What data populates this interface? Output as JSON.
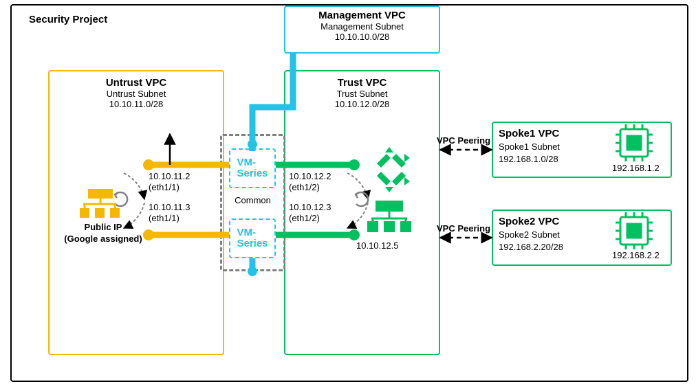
{
  "project": {
    "title": "Security Project"
  },
  "mgmt": {
    "title": "Management VPC",
    "subnet_name": "Management Subnet",
    "cidr": "10.10.10.0/28"
  },
  "untrust": {
    "title": "Untrust VPC",
    "subnet_name": "Untrust Subnet",
    "cidr": "10.10.11.0/28",
    "ip1": "10.10.11.2",
    "if1": "(eth1/1)",
    "ip2": "10.10.11.3",
    "if2": "(eth1/1)",
    "public_ip_l1": "Public IP",
    "public_ip_l2": "(Google assigned)"
  },
  "vmseries": {
    "label": "VM-\nSeries",
    "group": "Common"
  },
  "trust": {
    "title": "Trust VPC",
    "subnet_name": "Trust Subnet",
    "cidr": "10.10.12.0/28",
    "ip1": "10.10.12.2",
    "if1": "(eth1/2)",
    "ip2": "10.10.12.3",
    "if2": "(eth1/2)",
    "lb_ip": "10.10.12.5"
  },
  "peering": {
    "label1": "VPC Peering",
    "label2": "VPC Peering"
  },
  "spoke1": {
    "title": "Spoke1 VPC",
    "subnet_name": "Spoke1 Subnet",
    "cidr": "192.168.1.0/28",
    "vm_ip": "192.168.1.2"
  },
  "spoke2": {
    "title": "Spoke2 VPC",
    "subnet_name": "Spoke2 Subnet",
    "cidr": "192.168.2.20/28",
    "vm_ip": "192.168.2.2"
  }
}
